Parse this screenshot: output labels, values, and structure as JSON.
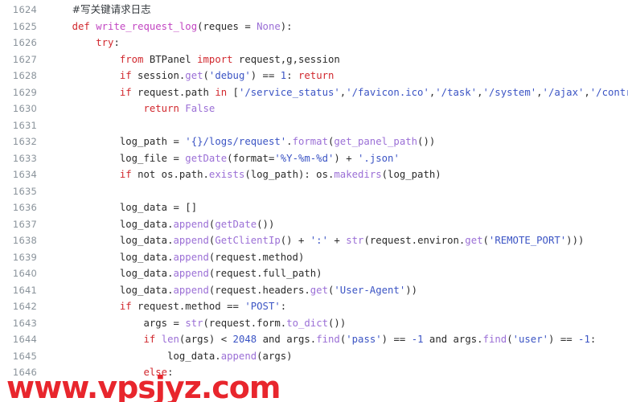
{
  "editor": {
    "language": "python",
    "first_line_number": 1624,
    "colors": {
      "background": "#ffffff",
      "gutter_text": "#8a939b",
      "default_text": "#2b2b2b",
      "keyword": "#d1282e",
      "function_name": "#c246c2",
      "string": "#3b54c4",
      "number": "#3b54c4",
      "method_call": "#9b6fd6",
      "constant": "#9b6fd6",
      "comment": "#33383d",
      "watermark": "#e8262d"
    },
    "lines": [
      {
        "number": "1624",
        "tokens": [
          {
            "text": "    ",
            "type": "plain"
          },
          {
            "text": "#写关键请求日志",
            "type": "comment-cn"
          }
        ]
      },
      {
        "number": "1625",
        "tokens": [
          {
            "text": "    ",
            "type": "plain"
          },
          {
            "text": "def",
            "type": "def"
          },
          {
            "text": " ",
            "type": "plain"
          },
          {
            "text": "write_request_log",
            "type": "fname"
          },
          {
            "text": "(reques ",
            "type": "plain"
          },
          {
            "text": "=",
            "type": "op"
          },
          {
            "text": " ",
            "type": "plain"
          },
          {
            "text": "None",
            "type": "const"
          },
          {
            "text": "):",
            "type": "plain"
          }
        ]
      },
      {
        "number": "1626",
        "tokens": [
          {
            "text": "        ",
            "type": "plain"
          },
          {
            "text": "try",
            "type": "kw"
          },
          {
            "text": ":",
            "type": "plain"
          }
        ]
      },
      {
        "number": "1627",
        "tokens": [
          {
            "text": "            ",
            "type": "plain"
          },
          {
            "text": "from",
            "type": "kw"
          },
          {
            "text": " BTPanel ",
            "type": "plain"
          },
          {
            "text": "import",
            "type": "kw"
          },
          {
            "text": " request,g,session",
            "type": "plain"
          }
        ]
      },
      {
        "number": "1628",
        "tokens": [
          {
            "text": "            ",
            "type": "plain"
          },
          {
            "text": "if",
            "type": "kw"
          },
          {
            "text": " session.",
            "type": "plain"
          },
          {
            "text": "get",
            "type": "call"
          },
          {
            "text": "(",
            "type": "plain"
          },
          {
            "text": "'debug'",
            "type": "str"
          },
          {
            "text": ") == ",
            "type": "plain"
          },
          {
            "text": "1",
            "type": "num"
          },
          {
            "text": ": ",
            "type": "plain"
          },
          {
            "text": "return",
            "type": "kw"
          }
        ]
      },
      {
        "number": "1629",
        "tokens": [
          {
            "text": "            ",
            "type": "plain"
          },
          {
            "text": "if",
            "type": "kw"
          },
          {
            "text": " request.path ",
            "type": "plain"
          },
          {
            "text": "in",
            "type": "kw"
          },
          {
            "text": " [",
            "type": "plain"
          },
          {
            "text": "'/service_status'",
            "type": "str"
          },
          {
            "text": ",",
            "type": "plain"
          },
          {
            "text": "'/favicon.ico'",
            "type": "str"
          },
          {
            "text": ",",
            "type": "plain"
          },
          {
            "text": "'/task'",
            "type": "str"
          },
          {
            "text": ",",
            "type": "plain"
          },
          {
            "text": "'/system'",
            "type": "str"
          },
          {
            "text": ",",
            "type": "plain"
          },
          {
            "text": "'/ajax'",
            "type": "str"
          },
          {
            "text": ",",
            "type": "plain"
          },
          {
            "text": "'/control'",
            "type": "str"
          },
          {
            "text": ",",
            "type": "plain"
          }
        ]
      },
      {
        "number": "1630",
        "tokens": [
          {
            "text": "                ",
            "type": "plain"
          },
          {
            "text": "return",
            "type": "kw"
          },
          {
            "text": " ",
            "type": "plain"
          },
          {
            "text": "False",
            "type": "const"
          }
        ]
      },
      {
        "number": "1631",
        "tokens": []
      },
      {
        "number": "1632",
        "tokens": [
          {
            "text": "            ",
            "type": "plain"
          },
          {
            "text": "log_path ",
            "type": "plain"
          },
          {
            "text": "=",
            "type": "op"
          },
          {
            "text": " ",
            "type": "plain"
          },
          {
            "text": "'{}/logs/request'",
            "type": "str"
          },
          {
            "text": ".",
            "type": "plain"
          },
          {
            "text": "format",
            "type": "call"
          },
          {
            "text": "(",
            "type": "plain"
          },
          {
            "text": "get_panel_path",
            "type": "call"
          },
          {
            "text": "())",
            "type": "plain"
          }
        ]
      },
      {
        "number": "1633",
        "tokens": [
          {
            "text": "            ",
            "type": "plain"
          },
          {
            "text": "log_file ",
            "type": "plain"
          },
          {
            "text": "=",
            "type": "op"
          },
          {
            "text": " ",
            "type": "plain"
          },
          {
            "text": "getDate",
            "type": "call"
          },
          {
            "text": "(format=",
            "type": "plain"
          },
          {
            "text": "'%Y-%m-%d'",
            "type": "str"
          },
          {
            "text": ") + ",
            "type": "plain"
          },
          {
            "text": "'.json'",
            "type": "str"
          }
        ]
      },
      {
        "number": "1634",
        "tokens": [
          {
            "text": "            ",
            "type": "plain"
          },
          {
            "text": "if",
            "type": "kw"
          },
          {
            "text": " ",
            "type": "plain"
          },
          {
            "text": "not",
            "type": "plain"
          },
          {
            "text": " os.path.",
            "type": "plain"
          },
          {
            "text": "exists",
            "type": "call"
          },
          {
            "text": "(log_path): os.",
            "type": "plain"
          },
          {
            "text": "makedirs",
            "type": "call"
          },
          {
            "text": "(log_path)",
            "type": "plain"
          }
        ]
      },
      {
        "number": "1635",
        "tokens": []
      },
      {
        "number": "1636",
        "tokens": [
          {
            "text": "            ",
            "type": "plain"
          },
          {
            "text": "log_data ",
            "type": "plain"
          },
          {
            "text": "=",
            "type": "op"
          },
          {
            "text": " []",
            "type": "plain"
          }
        ]
      },
      {
        "number": "1637",
        "tokens": [
          {
            "text": "            ",
            "type": "plain"
          },
          {
            "text": "log_data.",
            "type": "plain"
          },
          {
            "text": "append",
            "type": "call"
          },
          {
            "text": "(",
            "type": "plain"
          },
          {
            "text": "getDate",
            "type": "call"
          },
          {
            "text": "())",
            "type": "plain"
          }
        ]
      },
      {
        "number": "1638",
        "tokens": [
          {
            "text": "            ",
            "type": "plain"
          },
          {
            "text": "log_data.",
            "type": "plain"
          },
          {
            "text": "append",
            "type": "call"
          },
          {
            "text": "(",
            "type": "plain"
          },
          {
            "text": "GetClientIp",
            "type": "call"
          },
          {
            "text": "() + ",
            "type": "plain"
          },
          {
            "text": "':'",
            "type": "str"
          },
          {
            "text": " + ",
            "type": "plain"
          },
          {
            "text": "str",
            "type": "call"
          },
          {
            "text": "(request.environ.",
            "type": "plain"
          },
          {
            "text": "get",
            "type": "call"
          },
          {
            "text": "(",
            "type": "plain"
          },
          {
            "text": "'REMOTE_PORT'",
            "type": "str"
          },
          {
            "text": ")))",
            "type": "plain"
          }
        ]
      },
      {
        "number": "1639",
        "tokens": [
          {
            "text": "            ",
            "type": "plain"
          },
          {
            "text": "log_data.",
            "type": "plain"
          },
          {
            "text": "append",
            "type": "call"
          },
          {
            "text": "(request.method)",
            "type": "plain"
          }
        ]
      },
      {
        "number": "1640",
        "tokens": [
          {
            "text": "            ",
            "type": "plain"
          },
          {
            "text": "log_data.",
            "type": "plain"
          },
          {
            "text": "append",
            "type": "call"
          },
          {
            "text": "(request.full_path)",
            "type": "plain"
          }
        ]
      },
      {
        "number": "1641",
        "tokens": [
          {
            "text": "            ",
            "type": "plain"
          },
          {
            "text": "log_data.",
            "type": "plain"
          },
          {
            "text": "append",
            "type": "call"
          },
          {
            "text": "(request.headers.",
            "type": "plain"
          },
          {
            "text": "get",
            "type": "call"
          },
          {
            "text": "(",
            "type": "plain"
          },
          {
            "text": "'User-Agent'",
            "type": "str"
          },
          {
            "text": "))",
            "type": "plain"
          }
        ]
      },
      {
        "number": "1642",
        "tokens": [
          {
            "text": "            ",
            "type": "plain"
          },
          {
            "text": "if",
            "type": "kw"
          },
          {
            "text": " request.method == ",
            "type": "plain"
          },
          {
            "text": "'POST'",
            "type": "str"
          },
          {
            "text": ":",
            "type": "plain"
          }
        ]
      },
      {
        "number": "1643",
        "tokens": [
          {
            "text": "                ",
            "type": "plain"
          },
          {
            "text": "args ",
            "type": "plain"
          },
          {
            "text": "=",
            "type": "op"
          },
          {
            "text": " ",
            "type": "plain"
          },
          {
            "text": "str",
            "type": "call"
          },
          {
            "text": "(request.form.",
            "type": "plain"
          },
          {
            "text": "to_dict",
            "type": "call"
          },
          {
            "text": "())",
            "type": "plain"
          }
        ]
      },
      {
        "number": "1644",
        "tokens": [
          {
            "text": "                ",
            "type": "plain"
          },
          {
            "text": "if",
            "type": "kw"
          },
          {
            "text": " ",
            "type": "plain"
          },
          {
            "text": "len",
            "type": "call"
          },
          {
            "text": "(args) < ",
            "type": "plain"
          },
          {
            "text": "2048",
            "type": "num"
          },
          {
            "text": " and args.",
            "type": "plain"
          },
          {
            "text": "find",
            "type": "call"
          },
          {
            "text": "(",
            "type": "plain"
          },
          {
            "text": "'pass'",
            "type": "str"
          },
          {
            "text": ") == ",
            "type": "plain"
          },
          {
            "text": "-1",
            "type": "num"
          },
          {
            "text": " and args.",
            "type": "plain"
          },
          {
            "text": "find",
            "type": "call"
          },
          {
            "text": "(",
            "type": "plain"
          },
          {
            "text": "'user'",
            "type": "str"
          },
          {
            "text": ") == ",
            "type": "plain"
          },
          {
            "text": "-1",
            "type": "num"
          },
          {
            "text": ":",
            "type": "plain"
          }
        ]
      },
      {
        "number": "1645",
        "tokens": [
          {
            "text": "                    ",
            "type": "plain"
          },
          {
            "text": "log_data.",
            "type": "plain"
          },
          {
            "text": "append",
            "type": "call"
          },
          {
            "text": "(args)",
            "type": "plain"
          }
        ]
      },
      {
        "number": "1646",
        "tokens": [
          {
            "text": "                ",
            "type": "plain"
          },
          {
            "text": "else",
            "type": "kw"
          },
          {
            "text": ":",
            "type": "plain"
          }
        ]
      }
    ]
  },
  "watermark": {
    "text": "www.vpsjyz.com"
  }
}
